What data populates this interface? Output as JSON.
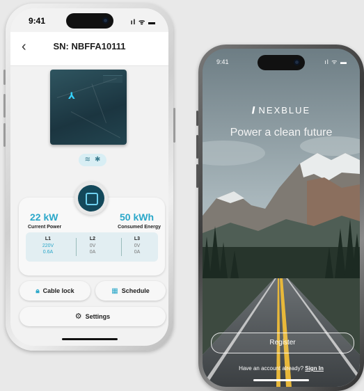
{
  "left_phone": {
    "status_time": "9:41",
    "status_icons": "ıl ᯤ ▬",
    "header": {
      "back_icon": "‹",
      "title": "SN: NBFFA10111"
    },
    "connectivity": {
      "wifi_icon": "≋",
      "bluetooth_icon": "✱"
    },
    "stats": {
      "current_power_value": "22 kW",
      "current_power_label": "Current Power",
      "consumed_energy_value": "50 kWh",
      "consumed_energy_label": "Consumed Energy",
      "phases": [
        {
          "name": "L1",
          "voltage": "220V",
          "current": "0.6A"
        },
        {
          "name": "L2",
          "voltage": "0V",
          "current": "0A"
        },
        {
          "name": "L3",
          "voltage": "0V",
          "current": "0A"
        }
      ]
    },
    "buttons": {
      "cable_lock_label": "Cable lock",
      "schedule_label": "Schedule",
      "settings_label": "Settings"
    },
    "icons": {
      "lock": "🔒︎",
      "schedule": "▦",
      "gear": "⚙"
    }
  },
  "right_phone": {
    "status_time": "9:41",
    "status_icons": "ıl ᯤ ▬",
    "brand_name": "NEXBLUE",
    "tagline": "Power a clean future",
    "register_label": "Register",
    "signin_prompt": "Have an account already?",
    "signin_link": "Sign In"
  },
  "colors": {
    "accent": "#2aa7c9",
    "stop_button": "#13485a"
  }
}
